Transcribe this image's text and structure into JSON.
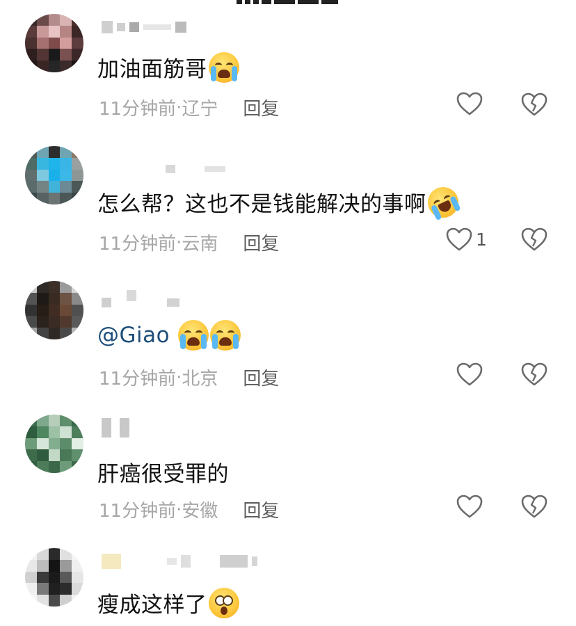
{
  "comments": [
    {
      "text": "加油面筋哥",
      "emojis": [
        "loudly-crying-face-emoji"
      ],
      "time": "11分钟前",
      "location": "辽宁",
      "reply_label": "回复",
      "like_count": ""
    },
    {
      "text": "怎么帮？这也不是钱能解决的事啊",
      "emojis": [
        "rolling-on-floor-laughing-emoji"
      ],
      "time": "11分钟前",
      "location": "云南",
      "reply_label": "回复",
      "like_count": "1"
    },
    {
      "text": "@Giao",
      "emojis": [
        "loudly-crying-face-emoji",
        "loudly-crying-face-emoji"
      ],
      "time": "11分钟前",
      "location": "北京",
      "reply_label": "回复",
      "like_count": ""
    },
    {
      "text": "肝癌很受罪的",
      "emojis": [],
      "time": "11分钟前",
      "location": "安徽",
      "reply_label": "回复",
      "like_count": ""
    },
    {
      "text": "瘦成这样了",
      "emojis": [
        "astonished-face-emoji"
      ],
      "time": "",
      "location": "",
      "reply_label": "",
      "like_count": ""
    }
  ],
  "meta_separator": " · ",
  "icons": {
    "like": "heart-outline-icon",
    "dislike": "broken-heart-icon"
  },
  "colors": {
    "text": "#111111",
    "meta": "#a6a6a6",
    "reply": "#5d5d5d",
    "mention": "#1e4e7a",
    "icon_stroke": "#6a6a6a"
  }
}
